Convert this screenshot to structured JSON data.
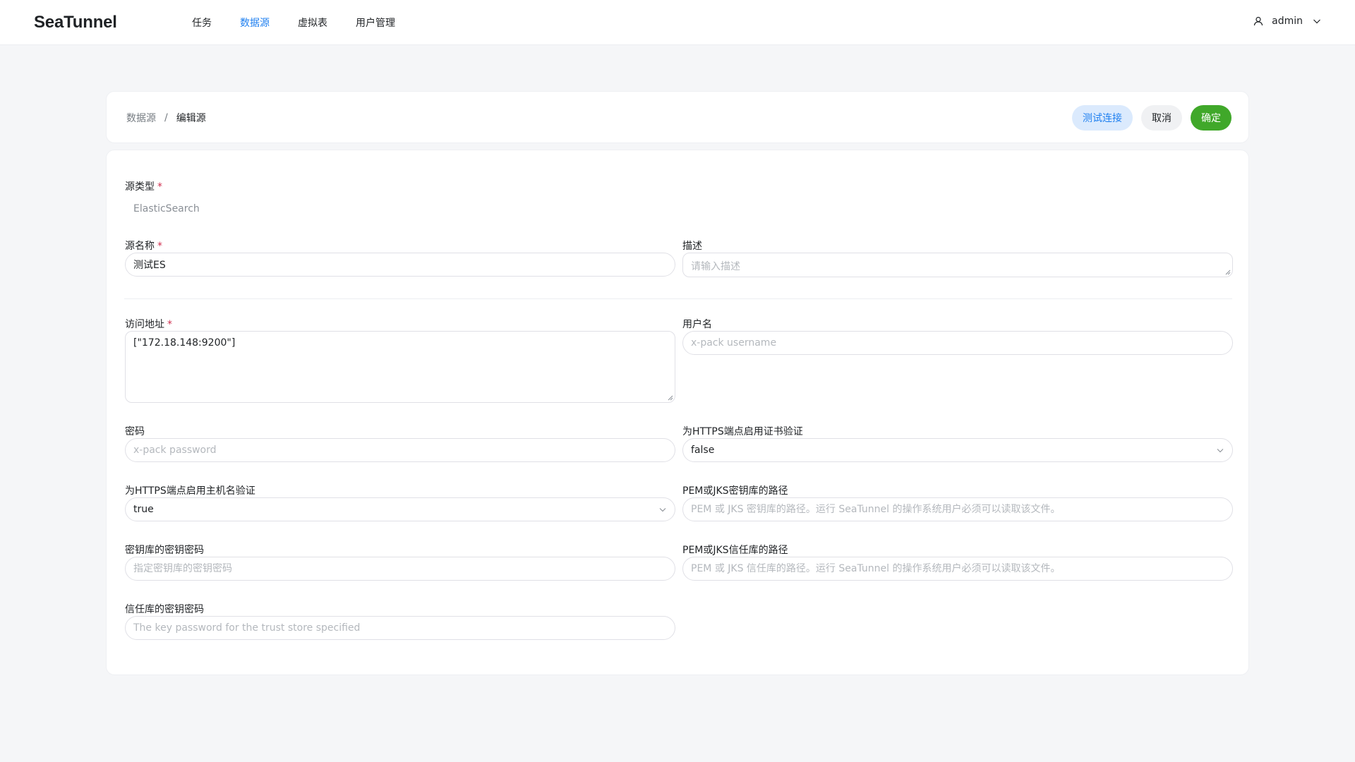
{
  "app": {
    "logo": "SeaTunnel",
    "nav": [
      "任务",
      "数据源",
      "虚拟表",
      "用户管理"
    ],
    "user": "admin"
  },
  "breadcrumb": {
    "parent": "数据源",
    "separator": "/",
    "current": "编辑源"
  },
  "actions": {
    "test": "测试连接",
    "cancel": "取消",
    "ok": "确定"
  },
  "form": {
    "source_type": {
      "label": "源类型",
      "value": "ElasticSearch"
    },
    "source_name": {
      "label": "源名称",
      "value": "测试ES"
    },
    "description": {
      "label": "描述",
      "placeholder": "请输入描述"
    },
    "hosts": {
      "label": "访问地址",
      "value": "[\"172.18.148:9200\"]"
    },
    "username": {
      "label": "用户名",
      "placeholder": "x-pack username"
    },
    "password": {
      "label": "密码",
      "placeholder": "x-pack password"
    },
    "tls_verify_certificate": {
      "label": "为HTTPS端点启用证书验证",
      "value": "false"
    },
    "tls_verify_hostname": {
      "label": "为HTTPS端点启用主机名验证",
      "value": "true"
    },
    "tls_keystore_path": {
      "label": "PEM或JKS密钥库的路径",
      "placeholder": "PEM 或 JKS 密钥库的路径。运行 SeaTunnel 的操作系统用户必须可以读取该文件。"
    },
    "tls_keystore_password": {
      "label": "密钥库的密钥密码",
      "placeholder": "指定密钥库的密钥密码"
    },
    "tls_truststore_path": {
      "label": "PEM或JKS信任库的路径",
      "placeholder": "PEM 或 JKS 信任库的路径。运行 SeaTunnel 的操作系统用户必须可以读取该文件。"
    },
    "tls_truststore_password": {
      "label": "信任库的密钥密码",
      "placeholder": "The key password for the trust store specified"
    },
    "required_mark": "*"
  },
  "colors": {
    "primary": "#2080f0",
    "success": "#40a82a",
    "required": "#d03050"
  }
}
